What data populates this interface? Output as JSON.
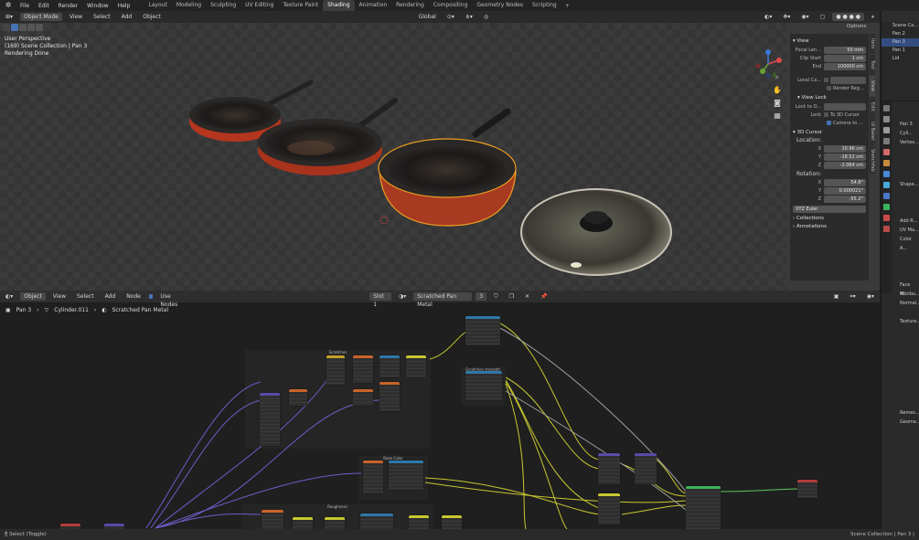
{
  "topbar": {
    "menus": [
      "File",
      "Edit",
      "Render",
      "Window",
      "Help"
    ],
    "workspaces": [
      "Layout",
      "Modeling",
      "Sculpting",
      "UV Editing",
      "Texture Paint",
      "Shading",
      "Animation",
      "Rendering",
      "Compositing",
      "Geometry Nodes",
      "Scripting"
    ],
    "active_workspace": "Shading"
  },
  "viewport": {
    "mode": "Object Mode",
    "menus": [
      "View",
      "Select",
      "Add",
      "Object"
    ],
    "orientation": "Global",
    "options_label": "Options",
    "info_line1": "User Perspective",
    "info_line2": "(169) Scene Collection | Pan 3",
    "info_line3": "Rendering Done"
  },
  "npanel": {
    "view_section": "View",
    "focal_label": "Focal Len...",
    "focal_value": "50 mm",
    "clip_start_label": "Clip Start",
    "clip_start_value": "1 cm",
    "clip_end_label": "End",
    "clip_end_value": "100000 cm",
    "local_camera_label": "Local Ca...",
    "render_region_label": "Render Reg...",
    "view_lock_section": "View Lock",
    "lock_to_label": "Lock to O...",
    "lock_label": "Lock",
    "to_3d_cursor_label": "To 3D Cursor",
    "camera_to_label": "Camera to ...",
    "cursor_section": "3D Cursor",
    "location_label": "Location:",
    "loc_x": "10.96 cm",
    "loc_y": "-18.52 cm",
    "loc_z": "-2.064 cm",
    "rotation_label": "Rotation:",
    "rot_x": "54.8°",
    "rot_y": "0.000021°",
    "rot_z": "-55.2°",
    "rot_mode": "XYZ Euler",
    "collections_section": "Collections",
    "annotations_section": "Annotations",
    "tabs": [
      "Item",
      "Tool",
      "View",
      "Edit",
      "UI Baker",
      "Sketchfab"
    ]
  },
  "outliner": {
    "rows": [
      "Scene Co...",
      "Pan 2",
      "Pan 3",
      "Pan 1",
      "Lid"
    ]
  },
  "properties": {
    "object_name": "Pan 3",
    "mesh_name": "Cyli...",
    "sections": [
      "Vertex...",
      "Shape...",
      "Add R...",
      "UV Ma...",
      "Color A...",
      "Face M...",
      "Attribu...",
      "Normal...",
      "Texture...",
      "Remes...",
      "Geome..."
    ]
  },
  "shader": {
    "mode": "Object",
    "menus": [
      "View",
      "Select",
      "Add",
      "Node"
    ],
    "use_nodes_label": "Use Nodes",
    "slot": "Slot 1",
    "material": "Scratched Pan Metal",
    "users": "3",
    "breadcrumb_object": "Pan 3",
    "breadcrumb_mesh": "Cylinder.011",
    "breadcrumb_material": "Scratched Pan Metal",
    "frame_scratches": "Scratches",
    "frame_scratches_strength": "Scratches strength",
    "frame_base_color": "Base Color",
    "frame_roughness": "Roughness"
  },
  "status": {
    "left": "Select (Toggle)",
    "right": "Scene Collection | Pan 3 |"
  },
  "colors": {
    "accent": "#4772b3",
    "selection_outline": "#f0a020",
    "noodle_yellow": "#c8c832",
    "noodle_purple": "#6e5cc8",
    "noodle_gray": "#a0a0a0"
  }
}
